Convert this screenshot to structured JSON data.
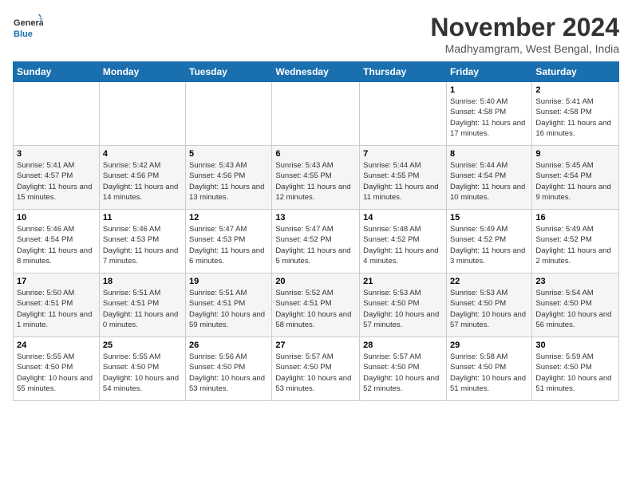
{
  "header": {
    "logo_line1": "General",
    "logo_line2": "Blue",
    "month_title": "November 2024",
    "subtitle": "Madhyamgram, West Bengal, India"
  },
  "weekdays": [
    "Sunday",
    "Monday",
    "Tuesday",
    "Wednesday",
    "Thursday",
    "Friday",
    "Saturday"
  ],
  "weeks": [
    [
      {
        "day": "",
        "info": ""
      },
      {
        "day": "",
        "info": ""
      },
      {
        "day": "",
        "info": ""
      },
      {
        "day": "",
        "info": ""
      },
      {
        "day": "",
        "info": ""
      },
      {
        "day": "1",
        "info": "Sunrise: 5:40 AM\nSunset: 4:58 PM\nDaylight: 11 hours and 17 minutes."
      },
      {
        "day": "2",
        "info": "Sunrise: 5:41 AM\nSunset: 4:58 PM\nDaylight: 11 hours and 16 minutes."
      }
    ],
    [
      {
        "day": "3",
        "info": "Sunrise: 5:41 AM\nSunset: 4:57 PM\nDaylight: 11 hours and 15 minutes."
      },
      {
        "day": "4",
        "info": "Sunrise: 5:42 AM\nSunset: 4:56 PM\nDaylight: 11 hours and 14 minutes."
      },
      {
        "day": "5",
        "info": "Sunrise: 5:43 AM\nSunset: 4:56 PM\nDaylight: 11 hours and 13 minutes."
      },
      {
        "day": "6",
        "info": "Sunrise: 5:43 AM\nSunset: 4:55 PM\nDaylight: 11 hours and 12 minutes."
      },
      {
        "day": "7",
        "info": "Sunrise: 5:44 AM\nSunset: 4:55 PM\nDaylight: 11 hours and 11 minutes."
      },
      {
        "day": "8",
        "info": "Sunrise: 5:44 AM\nSunset: 4:54 PM\nDaylight: 11 hours and 10 minutes."
      },
      {
        "day": "9",
        "info": "Sunrise: 5:45 AM\nSunset: 4:54 PM\nDaylight: 11 hours and 9 minutes."
      }
    ],
    [
      {
        "day": "10",
        "info": "Sunrise: 5:46 AM\nSunset: 4:54 PM\nDaylight: 11 hours and 8 minutes."
      },
      {
        "day": "11",
        "info": "Sunrise: 5:46 AM\nSunset: 4:53 PM\nDaylight: 11 hours and 7 minutes."
      },
      {
        "day": "12",
        "info": "Sunrise: 5:47 AM\nSunset: 4:53 PM\nDaylight: 11 hours and 6 minutes."
      },
      {
        "day": "13",
        "info": "Sunrise: 5:47 AM\nSunset: 4:52 PM\nDaylight: 11 hours and 5 minutes."
      },
      {
        "day": "14",
        "info": "Sunrise: 5:48 AM\nSunset: 4:52 PM\nDaylight: 11 hours and 4 minutes."
      },
      {
        "day": "15",
        "info": "Sunrise: 5:49 AM\nSunset: 4:52 PM\nDaylight: 11 hours and 3 minutes."
      },
      {
        "day": "16",
        "info": "Sunrise: 5:49 AM\nSunset: 4:52 PM\nDaylight: 11 hours and 2 minutes."
      }
    ],
    [
      {
        "day": "17",
        "info": "Sunrise: 5:50 AM\nSunset: 4:51 PM\nDaylight: 11 hours and 1 minute."
      },
      {
        "day": "18",
        "info": "Sunrise: 5:51 AM\nSunset: 4:51 PM\nDaylight: 11 hours and 0 minutes."
      },
      {
        "day": "19",
        "info": "Sunrise: 5:51 AM\nSunset: 4:51 PM\nDaylight: 10 hours and 59 minutes."
      },
      {
        "day": "20",
        "info": "Sunrise: 5:52 AM\nSunset: 4:51 PM\nDaylight: 10 hours and 58 minutes."
      },
      {
        "day": "21",
        "info": "Sunrise: 5:53 AM\nSunset: 4:50 PM\nDaylight: 10 hours and 57 minutes."
      },
      {
        "day": "22",
        "info": "Sunrise: 5:53 AM\nSunset: 4:50 PM\nDaylight: 10 hours and 57 minutes."
      },
      {
        "day": "23",
        "info": "Sunrise: 5:54 AM\nSunset: 4:50 PM\nDaylight: 10 hours and 56 minutes."
      }
    ],
    [
      {
        "day": "24",
        "info": "Sunrise: 5:55 AM\nSunset: 4:50 PM\nDaylight: 10 hours and 55 minutes."
      },
      {
        "day": "25",
        "info": "Sunrise: 5:55 AM\nSunset: 4:50 PM\nDaylight: 10 hours and 54 minutes."
      },
      {
        "day": "26",
        "info": "Sunrise: 5:56 AM\nSunset: 4:50 PM\nDaylight: 10 hours and 53 minutes."
      },
      {
        "day": "27",
        "info": "Sunrise: 5:57 AM\nSunset: 4:50 PM\nDaylight: 10 hours and 53 minutes."
      },
      {
        "day": "28",
        "info": "Sunrise: 5:57 AM\nSunset: 4:50 PM\nDaylight: 10 hours and 52 minutes."
      },
      {
        "day": "29",
        "info": "Sunrise: 5:58 AM\nSunset: 4:50 PM\nDaylight: 10 hours and 51 minutes."
      },
      {
        "day": "30",
        "info": "Sunrise: 5:59 AM\nSunset: 4:50 PM\nDaylight: 10 hours and 51 minutes."
      }
    ]
  ]
}
